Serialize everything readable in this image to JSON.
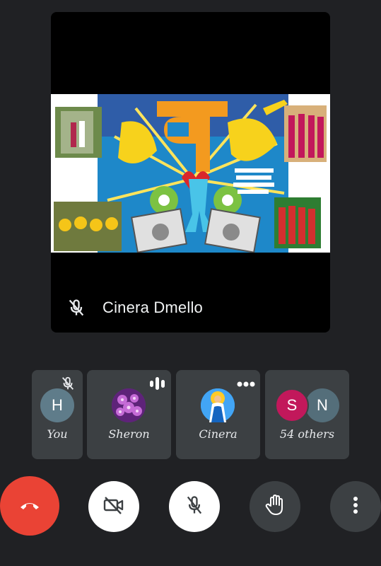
{
  "colors": {
    "background": "#202124",
    "tile_background": "#3c4043",
    "end_call": "#ea4335",
    "avatar_you": "#5f7c8a",
    "avatar_s": "#c2185b",
    "avatar_n": "#546e7a"
  },
  "main_speaker": {
    "name": "Cinera Dmello",
    "mic_icon": "mic-off-icon"
  },
  "participants": [
    {
      "label": "You",
      "avatar_letter": "H",
      "status_icon": "mic-off-icon"
    },
    {
      "label": "Sheron",
      "avatar_type": "photo-purple-flowers",
      "status_icon": "audio-level-icon"
    },
    {
      "label": "Cinera",
      "avatar_type": "photo-religious-figure",
      "status_icon": "more-dots-icon"
    },
    {
      "label": "54 others",
      "avatar_letters": [
        "S",
        "N"
      ]
    }
  ],
  "controls": {
    "end_call_icon": "hang-up-icon",
    "camera_icon": "camera-off-icon",
    "mic_icon": "mic-off-icon",
    "hand_icon": "raise-hand-icon",
    "more_icon": "more-vertical-icon"
  }
}
